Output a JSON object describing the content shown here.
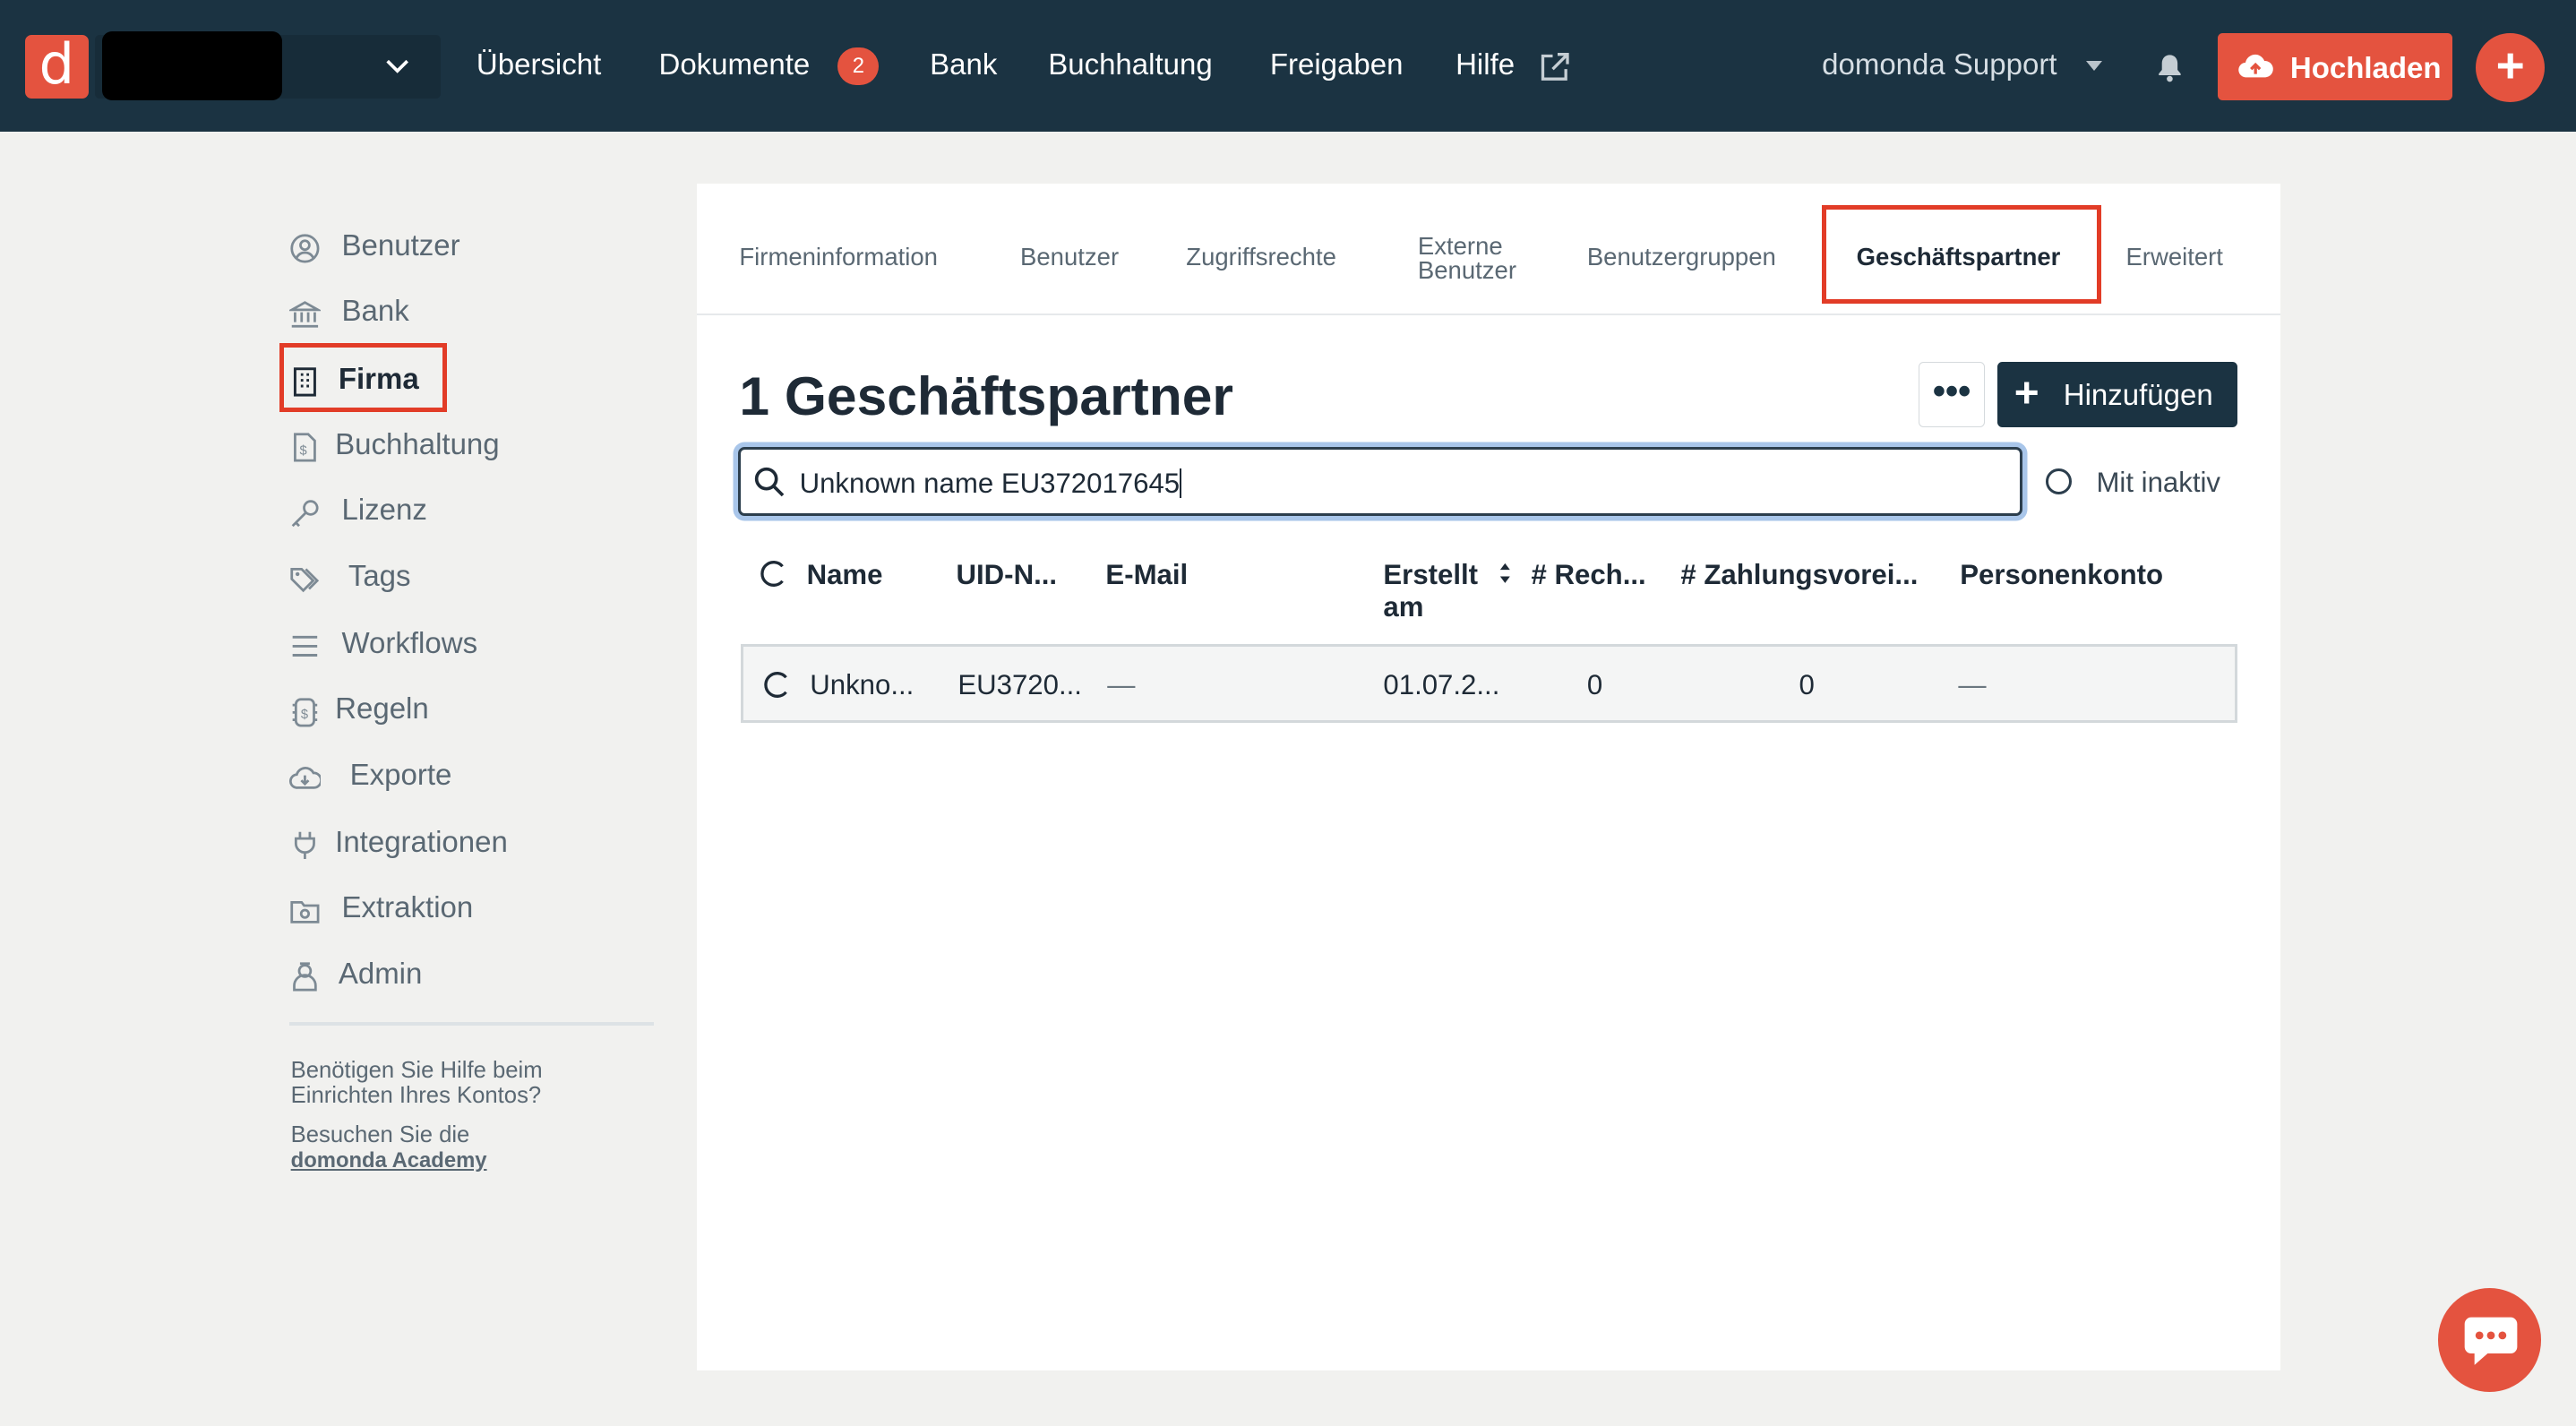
{
  "topbar": {
    "logo_letter": "d",
    "nav": [
      "Übersicht",
      "Dokumente",
      "Bank",
      "Buchhaltung",
      "Freigaben",
      "Hilfe"
    ],
    "dokumente_badge": "2",
    "user_menu": "domonda Support",
    "upload_label": "Hochladen",
    "plus_label": "+"
  },
  "sidebar": {
    "items": [
      "Benutzer",
      "Bank",
      "Firma",
      "Buchhaltung",
      "Lizenz",
      "Tags",
      "Workflows",
      "Regeln",
      "Exporte",
      "Integrationen",
      "Extraktion",
      "Admin"
    ],
    "active": "Firma",
    "help_line1": "Benötigen Sie Hilfe beim",
    "help_line2": "Einrichten Ihres Kontos?",
    "visit_text": "Besuchen Sie die",
    "academy_link": "domonda Academy"
  },
  "tabs": {
    "items": [
      "Firmeninformation",
      "Benutzer",
      "Zugriffsrechte",
      "Externe",
      "Benutzer",
      "Benutzergruppen",
      "Geschäftspartner",
      "Erweitert"
    ],
    "active": "Geschäftspartner"
  },
  "main": {
    "heading": "1 Geschäftspartner",
    "more_label": "•••",
    "add_label": "Hinzufügen",
    "search_value": "Unknown name EU372017645",
    "inactive_label": "Mit inaktiv"
  },
  "table": {
    "columns": [
      "Name",
      "UID-N...",
      "E-Mail",
      "Erstellt",
      "am",
      "# Rech...",
      "# Zahlungsvorei...",
      "Personenkonto"
    ],
    "rows": [
      [
        "Unkno...",
        "EU3720...",
        "—",
        "01.07.2...",
        "0",
        "0",
        "—"
      ]
    ]
  },
  "colors": {
    "topbar": "#1b3342",
    "accent": "#e4533f",
    "highlight_box": "#e23c27",
    "background": "#f1f1ef"
  },
  "icons": {
    "logo": "domonda-logo",
    "company_dropdown": "chevron-down-icon",
    "hilfe": "external-link-icon",
    "notifications": "bell-icon",
    "upload": "cloud-upload-icon",
    "chat": "chat-bubble-icon"
  }
}
